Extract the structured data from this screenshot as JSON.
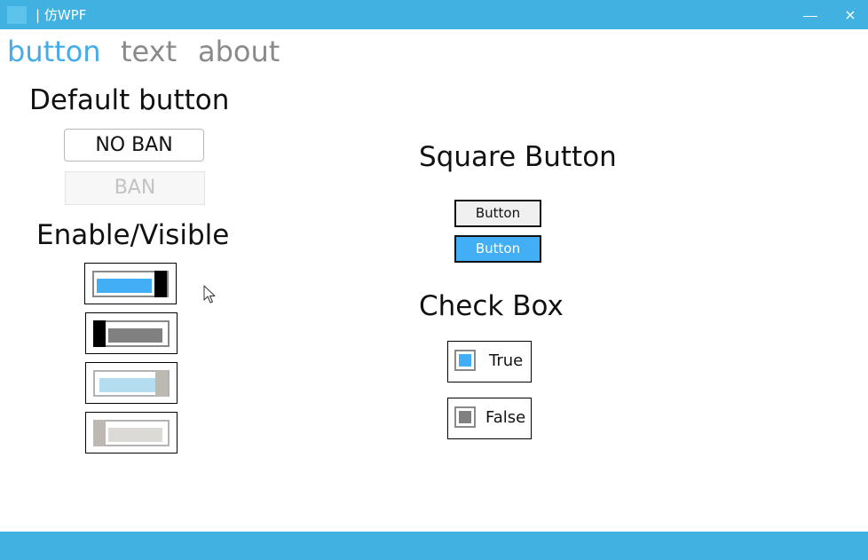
{
  "window": {
    "title": "| 仿WPF",
    "minimize_glyph": "—",
    "close_glyph": "×"
  },
  "nav": {
    "tabs": [
      {
        "label": "button",
        "active": true
      },
      {
        "label": "text",
        "active": false
      },
      {
        "label": "about",
        "active": false
      }
    ]
  },
  "default_button": {
    "heading": "Default button",
    "enabled_label": "NO BAN",
    "disabled_label": "BAN"
  },
  "toggles": {
    "heading": "Enable/Visible",
    "items": [
      {
        "checked": true,
        "enabled": true
      },
      {
        "checked": false,
        "enabled": true
      },
      {
        "checked": true,
        "enabled": false
      },
      {
        "checked": false,
        "enabled": false
      }
    ]
  },
  "square_button": {
    "heading": "Square Button",
    "buttons": [
      {
        "label": "Button",
        "style": "light"
      },
      {
        "label": "Button",
        "style": "primary"
      }
    ]
  },
  "check_box": {
    "heading": "Check Box",
    "items": [
      {
        "label": "True",
        "checked": true
      },
      {
        "label": "False",
        "checked": false
      }
    ]
  },
  "colors": {
    "title_bar": "#41b1e1",
    "accent": "#44ace8",
    "toggle_on": "#41aef5",
    "toggle_off": "#808080",
    "thumb_enabled": "#000000",
    "thumb_disabled": "#bdb8b1",
    "fill_on_disabled": "#b4def0",
    "fill_off_disabled": "#dcdad7",
    "check_on": "#41aef5",
    "check_off": "#808080"
  }
}
